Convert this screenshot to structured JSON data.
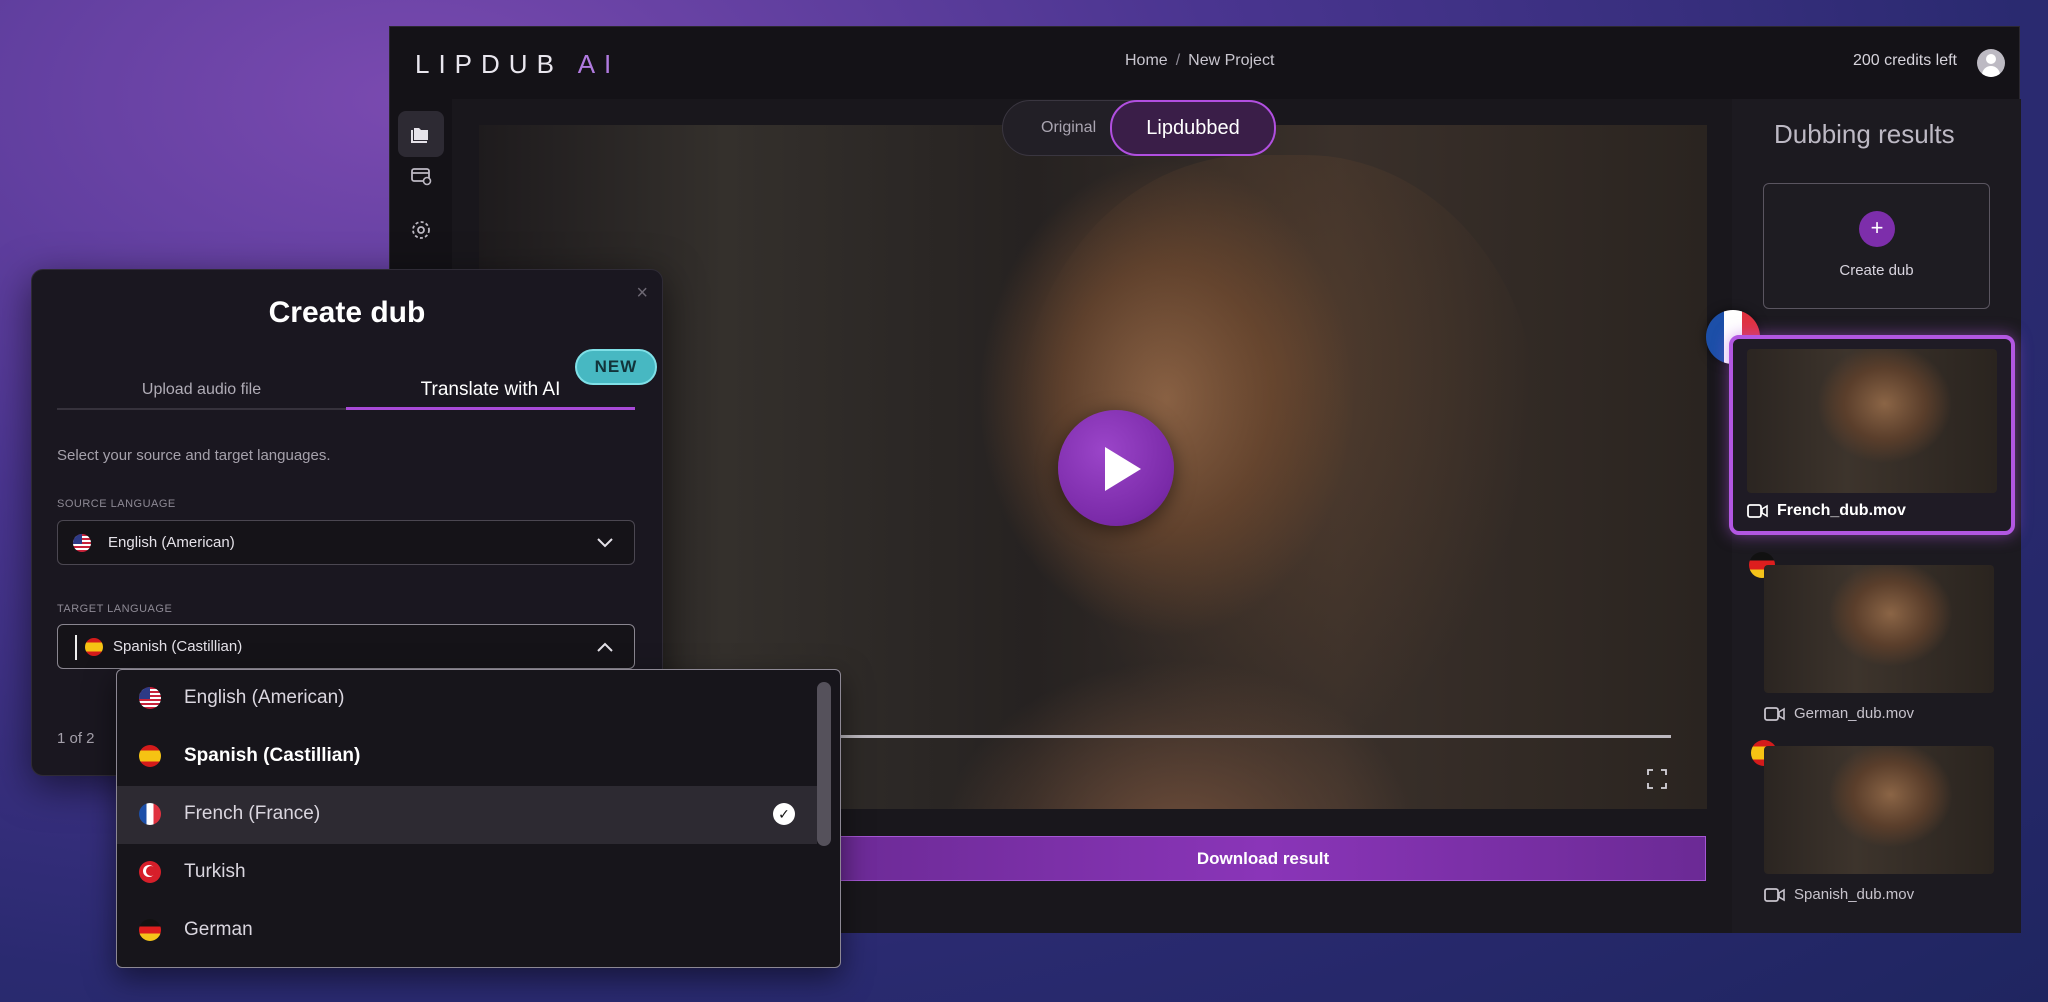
{
  "app": {
    "logo_main": "LIPDUB ",
    "logo_accent": "AI",
    "breadcrumb": {
      "home": "Home",
      "separator": "/",
      "current": "New Project"
    },
    "credits": "200 credits left"
  },
  "sidebar": {
    "items": [
      {
        "icon": "folder-icon"
      },
      {
        "icon": "billing-icon"
      },
      {
        "icon": "gear-icon"
      }
    ]
  },
  "player": {
    "toggle": {
      "original": "Original",
      "lipdubbed": "Lipdubbed"
    },
    "download_label": "Download result"
  },
  "results": {
    "title": "Dubbing results",
    "create_label": "Create dub",
    "create_plus": "+",
    "items": [
      {
        "name": "French_dub.mov",
        "flag": "fr",
        "selected": true
      },
      {
        "name": "German_dub.mov",
        "flag": "de",
        "selected": false
      },
      {
        "name": "Spanish_dub.mov",
        "flag": "es",
        "selected": false
      }
    ]
  },
  "dialog": {
    "title": "Create dub",
    "close": "×",
    "tabs": {
      "upload": "Upload audio file",
      "translate": "Translate with AI"
    },
    "new_badge": "NEW",
    "hint": "Select your source and target languages.",
    "source_label": "SOURCE LANGUAGE",
    "source_value": "English  (American)",
    "target_label": "TARGET LANGUAGE",
    "target_value": "Spanish  (Castillian)",
    "pager": "1 of 2"
  },
  "dropdown": {
    "options": [
      {
        "label": "English  (American)",
        "flag": "us"
      },
      {
        "label": "Spanish  (Castillian)",
        "flag": "es"
      },
      {
        "label": "French  (France)",
        "flag": "fr"
      },
      {
        "label": "Turkish",
        "flag": "tr"
      },
      {
        "label": "German",
        "flag": "de"
      }
    ],
    "check": "✓"
  },
  "colors": {
    "accent": "#a84ad8",
    "badge": "#47b8c2",
    "app_bg": "#141217"
  }
}
